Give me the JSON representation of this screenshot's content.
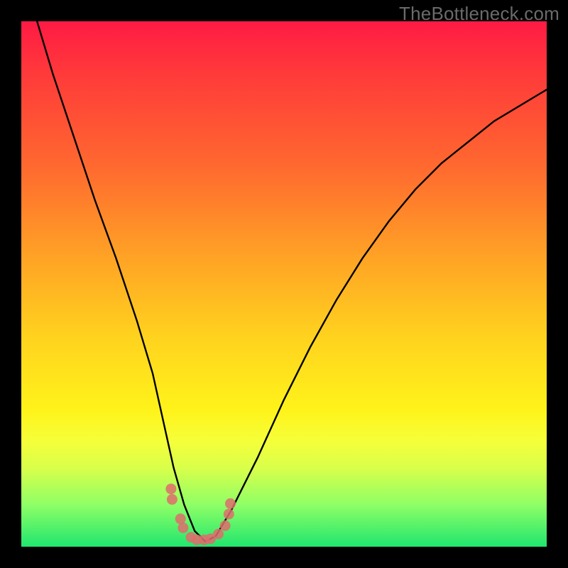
{
  "watermark": "TheBottleneck.com",
  "chart_data": {
    "type": "line",
    "title": "",
    "xlabel": "",
    "ylabel": "",
    "xlim": [
      0,
      100
    ],
    "ylim": [
      0,
      100
    ],
    "grid": false,
    "legend": false,
    "background_gradient_meaning": "bottleneck severity (top=red=high, bottom=green=low)",
    "series": [
      {
        "name": "bottleneck-curve",
        "color": "#000000",
        "x": [
          3,
          6,
          10,
          14,
          18,
          22,
          25,
          27,
          29,
          31,
          33,
          35,
          37,
          40,
          45,
          50,
          55,
          60,
          65,
          70,
          75,
          80,
          85,
          90,
          95,
          100
        ],
        "y": [
          100,
          90,
          78,
          66,
          55,
          43,
          33,
          24,
          15,
          8,
          3,
          1,
          2,
          7,
          17,
          28,
          38,
          47,
          55,
          62,
          68,
          73,
          77,
          81,
          84,
          87
        ]
      },
      {
        "name": "highlight-points",
        "color": "#e06868",
        "type": "scatter",
        "x": [
          28.5,
          28.7,
          30.3,
          30.8,
          32.3,
          33.4,
          34.8,
          36.0,
          37.5,
          38.8,
          39.5,
          39.8
        ],
        "y": [
          11.0,
          9.0,
          5.3,
          3.6,
          1.8,
          1.3,
          1.3,
          1.5,
          2.4,
          4.0,
          6.2,
          8.2
        ]
      }
    ],
    "minimum_at_x": 34
  }
}
